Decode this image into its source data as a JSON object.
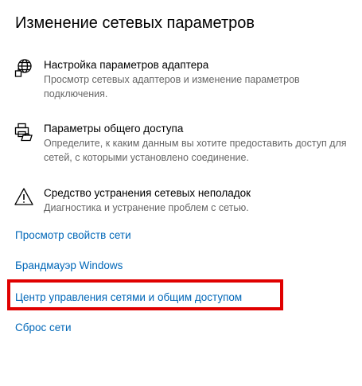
{
  "section": {
    "title": "Изменение сетевых параметров"
  },
  "options": [
    {
      "icon": "adapter-globe-icon",
      "title": "Настройка параметров адаптера",
      "description": "Просмотр сетевых адаптеров и изменение параметров подключения."
    },
    {
      "icon": "sharing-printer-icon",
      "title": "Параметры общего доступа",
      "description": "Определите, к каким данным вы хотите предоставить доступ для сетей, с которыми установлено соединение."
    },
    {
      "icon": "warning-triangle-icon",
      "title": "Средство устранения сетевых неполадок",
      "description": "Диагностика и устранение проблем с сетью."
    }
  ],
  "links": {
    "network_properties": "Просмотр свойств сети",
    "firewall": "Брандмауэр Windows",
    "sharing_center": "Центр управления сетями и общим доступом",
    "network_reset": "Сброс сети"
  },
  "colors": {
    "link": "#0067b8",
    "highlight": "#e00000",
    "description": "#666666"
  }
}
